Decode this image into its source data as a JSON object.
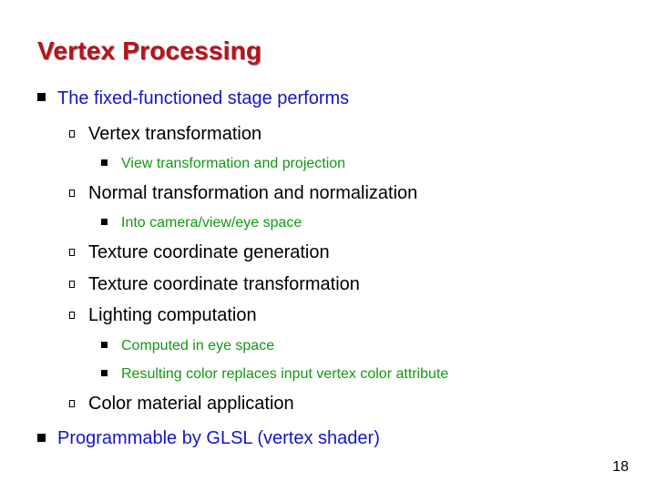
{
  "slide": {
    "title": "Vertex Processing",
    "items": [
      {
        "level": 1,
        "text": "The fixed-functioned stage performs"
      },
      {
        "level": 2,
        "text": "Vertex transformation"
      },
      {
        "level": 3,
        "text": "View transformation and projection"
      },
      {
        "level": 2,
        "text": "Normal transformation and normalization"
      },
      {
        "level": 3,
        "text": "Into camera/view/eye space"
      },
      {
        "level": 2,
        "text": "Texture coordinate generation"
      },
      {
        "level": 2,
        "text": "Texture coordinate transformation"
      },
      {
        "level": 2,
        "text": "Lighting computation"
      },
      {
        "level": 3,
        "text": "Computed in eye space"
      },
      {
        "level": 3,
        "text": "Resulting color replaces input vertex color attribute"
      },
      {
        "level": 2,
        "text": "Color material application"
      },
      {
        "level": 1,
        "text": "Programmable by GLSL (vertex shader)"
      }
    ],
    "page_number": "18"
  },
  "colors": {
    "title": "#b8121c",
    "level1": "#1515c8",
    "level2": "#000000",
    "level3": "#119911"
  }
}
